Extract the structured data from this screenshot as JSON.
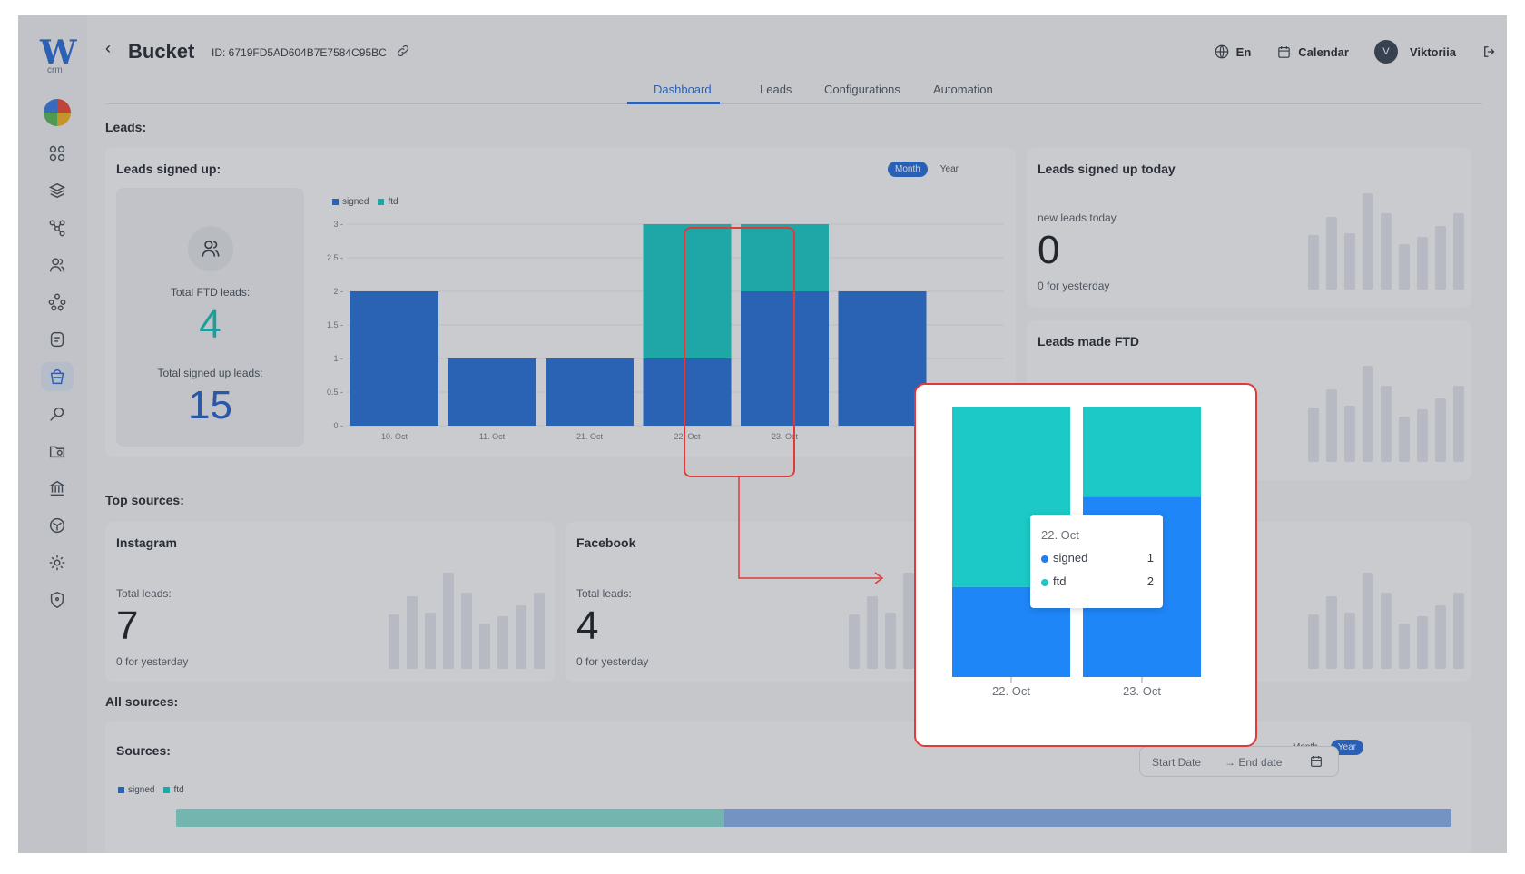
{
  "app": {
    "logo_text": "W",
    "logo_sub": "crm"
  },
  "header": {
    "back": "‹",
    "title": "Bucket",
    "id_text": "ID: 6719FD5AD604B7E7584C95BC",
    "language": "En",
    "calendar": "Calendar",
    "user_initial": "V",
    "user_name": "Viktoriia"
  },
  "tabs": [
    "Dashboard",
    "Leads",
    "Configurations",
    "Automation"
  ],
  "sections": {
    "leads": "Leads:",
    "top_sources": "Top sources:",
    "all_sources": "All sources:"
  },
  "leads_signed_up": {
    "title": "Leads signed up:",
    "total_ftd_label": "Total FTD leads:",
    "total_ftd_value": "4",
    "total_signed_label": "Total signed up leads:",
    "total_signed_value": "15",
    "period_month": "Month",
    "period_year": "Year"
  },
  "today_card": {
    "title": "Leads signed up today",
    "label": "new leads today",
    "value": "0",
    "note": "0 for yesterday"
  },
  "ftd_card": {
    "title": "Leads made FTD"
  },
  "sources": [
    {
      "title": "Instagram",
      "label": "Total leads:",
      "value": "7",
      "note": "0 for yesterday"
    },
    {
      "title": "Facebook",
      "label": "Total leads:",
      "value": "4",
      "note": "0 for yesterday"
    }
  ],
  "all_sources": {
    "title": "Sources:",
    "start_placeholder": "Start Date",
    "end_placeholder": "→ End date",
    "period_month": "Month",
    "period_year": "Year",
    "legend": [
      "signed",
      "ftd"
    ]
  },
  "colors": {
    "signed": "#2b72d8",
    "ftd": "#1cc9c6",
    "highlight": "#e03a3a",
    "accent": "#2b6fd8"
  },
  "chart_data": [
    {
      "type": "bar",
      "stacked": true,
      "categories": [
        "10. Oct",
        "11. Oct",
        "21. Oct",
        "22. Oct",
        "23. Oct",
        ""
      ],
      "series": [
        {
          "name": "signed",
          "values": [
            2,
            1,
            1,
            1,
            2,
            2
          ]
        },
        {
          "name": "ftd",
          "values": [
            0,
            0,
            0,
            2,
            1,
            0
          ]
        }
      ],
      "ylim": [
        0,
        3
      ],
      "yticks": [
        "0",
        "0.5",
        "1",
        "1.5",
        "2",
        "2.5",
        "3"
      ],
      "legend": "top-left",
      "grid": true
    },
    {
      "type": "bar",
      "stacked": true,
      "categories": [
        "22. Oct",
        "23. Oct"
      ],
      "series": [
        {
          "name": "signed",
          "values": [
            1,
            2
          ]
        },
        {
          "name": "ftd",
          "values": [
            2,
            1
          ]
        }
      ],
      "ylim": [
        0,
        3
      ],
      "tooltip": {
        "date": "22. Oct",
        "signed": "1",
        "ftd": "2"
      }
    }
  ]
}
